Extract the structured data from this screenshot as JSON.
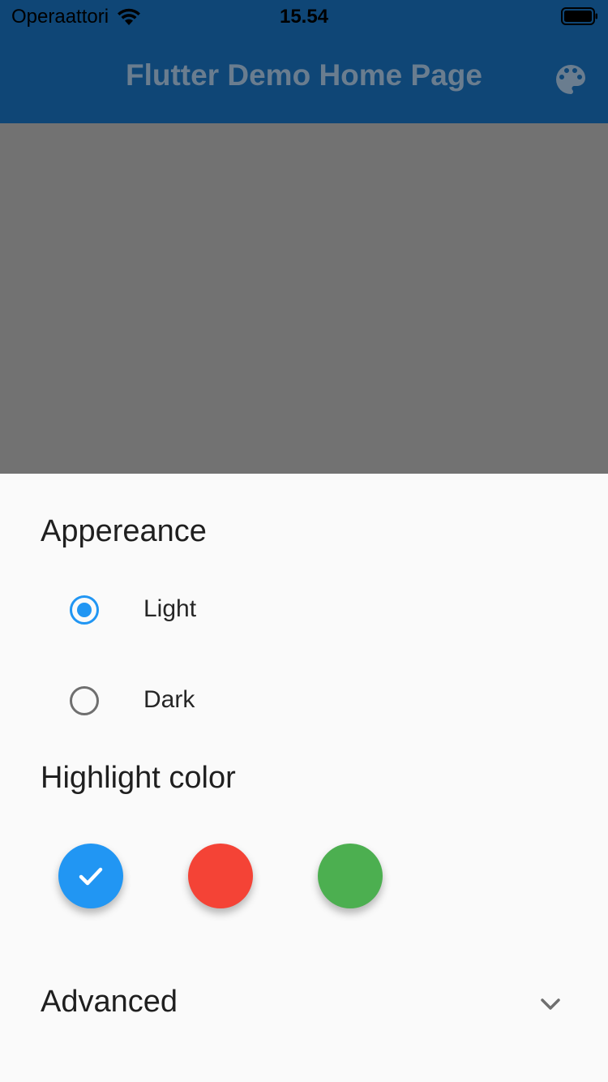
{
  "status_bar": {
    "carrier": "Operaattori",
    "time": "15.54",
    "wifi_icon": "wifi-icon",
    "battery_icon": "battery-icon"
  },
  "app_bar": {
    "title": "Flutter Demo Home Page",
    "background": "#0f4676",
    "action_icon": "palette-icon"
  },
  "sheet": {
    "appearance": {
      "title": "Appereance",
      "options": [
        {
          "label": "Light",
          "selected": true
        },
        {
          "label": "Dark",
          "selected": false
        }
      ]
    },
    "highlight": {
      "title": "Highlight color",
      "swatches": [
        {
          "name": "blue",
          "color": "#2196f3",
          "selected": true
        },
        {
          "name": "red",
          "color": "#f44336",
          "selected": false
        },
        {
          "name": "green",
          "color": "#4caf50",
          "selected": false
        }
      ]
    },
    "advanced": {
      "title": "Advanced",
      "icon": "chevron-down-icon"
    }
  }
}
